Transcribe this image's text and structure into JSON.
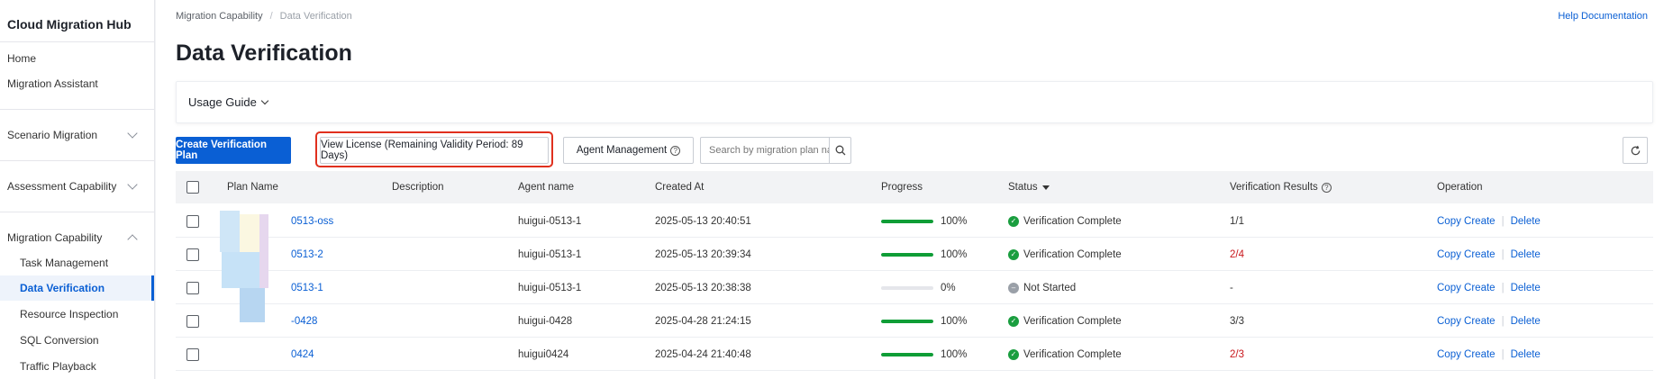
{
  "sidebar": {
    "brand": "Cloud Migration Hub",
    "items": [
      {
        "label": "Home"
      },
      {
        "label": "Migration Assistant"
      },
      {
        "label": "Scenario Migration"
      },
      {
        "label": "Assessment Capability"
      },
      {
        "label": "Migration Capability"
      },
      {
        "label": "Task Management"
      },
      {
        "label": "Data Verification"
      },
      {
        "label": "Resource Inspection"
      },
      {
        "label": "SQL Conversion"
      },
      {
        "label": "Traffic Playback"
      }
    ]
  },
  "header": {
    "breadcrumb": [
      "Migration Capability",
      "Data Verification"
    ],
    "breadcrumb_sep": "/",
    "help_link": "Help Documentation",
    "title": "Data Verification"
  },
  "guide": {
    "label": "Usage Guide"
  },
  "toolbar": {
    "create_label": "Create Verification Plan",
    "license_label": "View License (Remaining Validity Period: 89 Days)",
    "agent_label": "Agent Management",
    "search_placeholder": "Search by migration plan name",
    "qmark": "?"
  },
  "table": {
    "columns": [
      "Plan Name",
      "Description",
      "Agent name",
      "Created At",
      "Progress",
      "Status",
      "Verification Results",
      "Operation"
    ],
    "rows": [
      {
        "name": "0513-oss",
        "description": "",
        "agent": "huigui-0513-1",
        "created": "2025-05-13 20:40:51",
        "progress": 100,
        "progress_text": "100%",
        "status": "Verification Complete",
        "status_kind": "ok",
        "result": "1/1",
        "result_bad": false
      },
      {
        "name": "0513-2",
        "description": "",
        "agent": "huigui-0513-1",
        "created": "2025-05-13 20:39:34",
        "progress": 100,
        "progress_text": "100%",
        "status": "Verification Complete",
        "status_kind": "ok",
        "result": "2/4",
        "result_bad": true
      },
      {
        "name": "0513-1",
        "description": "",
        "agent": "huigui-0513-1",
        "created": "2025-05-13 20:38:38",
        "progress": 0,
        "progress_text": "0%",
        "status": "Not Started",
        "status_kind": "wait",
        "result": "-",
        "result_bad": false
      },
      {
        "name": "-0428",
        "description": "",
        "agent": "huigui-0428",
        "created": "2025-04-28 21:24:15",
        "progress": 100,
        "progress_text": "100%",
        "status": "Verification Complete",
        "status_kind": "ok",
        "result": "3/3",
        "result_bad": false
      },
      {
        "name": "0424",
        "description": "",
        "agent": "huigui0424",
        "created": "2025-04-24 21:40:48",
        "progress": 100,
        "progress_text": "100%",
        "status": "Verification Complete",
        "status_kind": "ok",
        "result": "2/3",
        "result_bad": true
      }
    ],
    "operations": {
      "copy": "Copy Create",
      "delete": "Delete",
      "sep": "|"
    }
  },
  "colors": {
    "accent": "#0a5fd4",
    "success": "#1a9e3f",
    "danger": "#c8171c",
    "highlight": "#e0301e"
  },
  "icons": {
    "check": "✓",
    "dash": "–"
  }
}
